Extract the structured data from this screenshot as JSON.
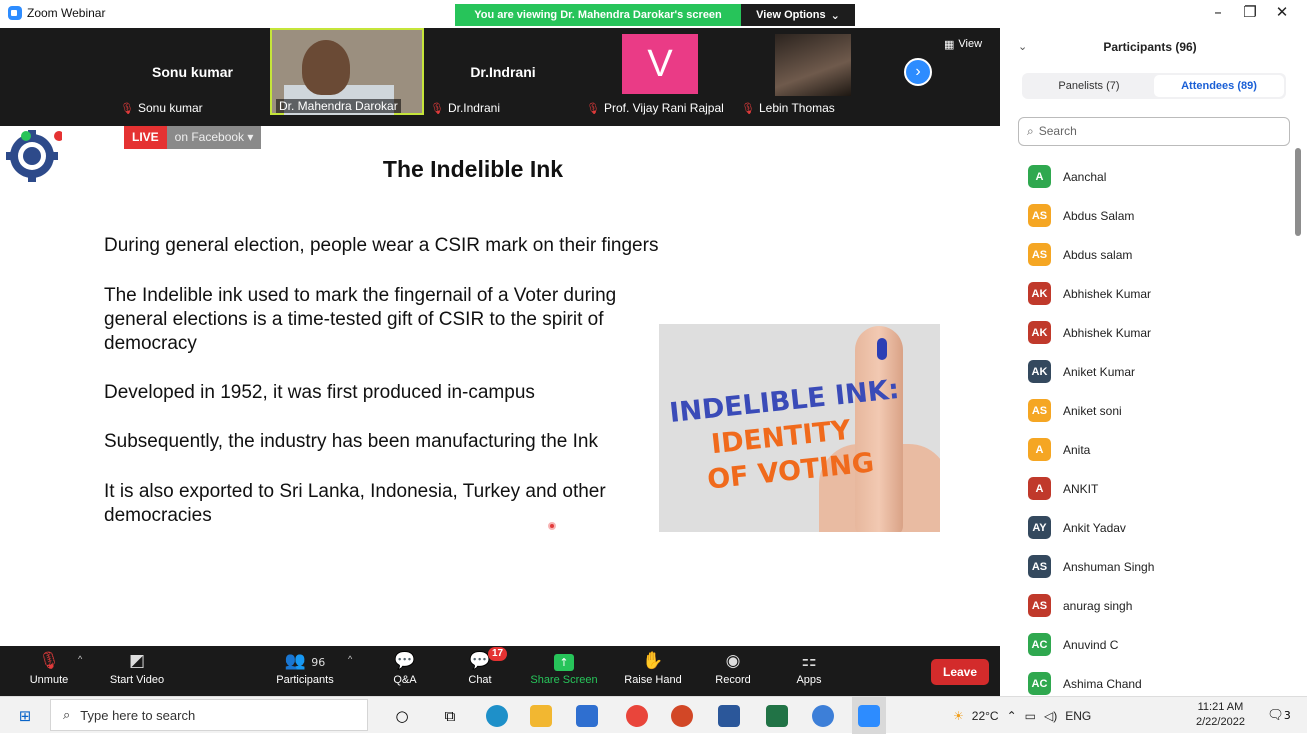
{
  "window": {
    "app_title": "Zoom Webinar",
    "viewing_banner": "You are viewing Dr. Mahendra Darokar's screen",
    "view_options": "View Options",
    "minimize": "–",
    "maximize": "❐",
    "close": "✕"
  },
  "strip": {
    "tiles": [
      {
        "name": "Sonu kumar",
        "label": "Sonu kumar"
      },
      {
        "label": "Dr. Mahendra Darokar"
      },
      {
        "name": "Dr.Indrani",
        "label": "Dr.Indrani"
      },
      {
        "avatar_letter": "V",
        "label": "Prof. Vijay Rani Rajpal"
      },
      {
        "label": "Lebin Thomas"
      }
    ],
    "view_label": "View"
  },
  "live": {
    "badge": "LIVE",
    "platform": "on Facebook"
  },
  "slide": {
    "title": "The Indelible Ink",
    "bullets": [
      "During general election, people wear a CSIR mark on their fingers",
      "The Indelible ink used to mark the fingernail of a Voter during general elections is a time-tested gift of CSIR to the spirit of democracy",
      "Developed in 1952, it was first produced in-campus",
      "Subsequently, the industry has been manufacturing the Ink",
      "It is also exported to Sri Lanka, Indonesia, Turkey and other democracies"
    ],
    "image_text": [
      "INDELIBLE INK:",
      "IDENTITY",
      "OF VOTING"
    ]
  },
  "toolbar": {
    "unmute": "Unmute",
    "start_video": "Start Video",
    "participants_count": "96",
    "participants": "Participants",
    "qa": "Q&A",
    "chat": "Chat",
    "chat_badge": "17",
    "share_screen": "Share Screen",
    "raise_hand": "Raise Hand",
    "record": "Record",
    "apps": "Apps",
    "leave": "Leave"
  },
  "panel": {
    "title": "Participants (96)",
    "tabs": [
      "Panelists (7)",
      "Attendees (89)"
    ],
    "search_placeholder": "Search",
    "attendees": [
      {
        "initials": "A",
        "name": "Aanchal",
        "color": "#2fa84f"
      },
      {
        "initials": "AS",
        "name": "Abdus Salam",
        "color": "#f5a623"
      },
      {
        "initials": "AS",
        "name": "Abdus salam",
        "color": "#f5a623"
      },
      {
        "initials": "AK",
        "name": "Abhishek Kumar",
        "color": "#c0392b"
      },
      {
        "initials": "AK",
        "name": "Abhishek Kumar",
        "color": "#c0392b"
      },
      {
        "initials": "AK",
        "name": "Aniket Kumar",
        "color": "#34495e"
      },
      {
        "initials": "AS",
        "name": "Aniket soni",
        "color": "#f5a623"
      },
      {
        "initials": "A",
        "name": "Anita",
        "color": "#f5a623"
      },
      {
        "initials": "A",
        "name": "ANKIT",
        "color": "#c0392b"
      },
      {
        "initials": "AY",
        "name": "Ankit Yadav",
        "color": "#34495e"
      },
      {
        "initials": "AS",
        "name": "Anshuman Singh",
        "color": "#34495e"
      },
      {
        "initials": "AS",
        "name": "anurag singh",
        "color": "#c0392b"
      },
      {
        "initials": "AC",
        "name": "Anuvind C",
        "color": "#2fa84f"
      },
      {
        "initials": "AC",
        "name": "Ashima Chand",
        "color": "#2fa84f"
      }
    ]
  },
  "taskbar": {
    "search_placeholder": "Type here to search",
    "weather": "22°C",
    "lang": "ENG",
    "time": "11:21 AM",
    "date": "2/22/2022",
    "notification_count": "3"
  }
}
